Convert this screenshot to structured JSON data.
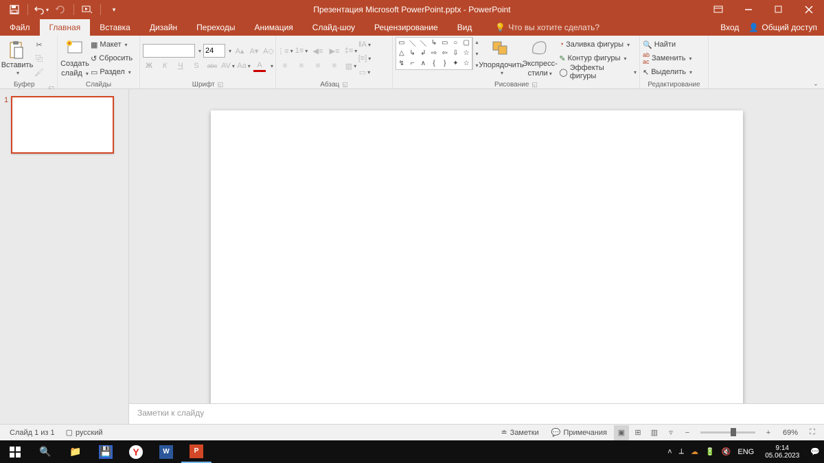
{
  "title": "Презентация Microsoft PowerPoint.pptx - PowerPoint",
  "tabs": {
    "file": "Файл",
    "home": "Главная",
    "insert": "Вставка",
    "design": "Дизайн",
    "transitions": "Переходы",
    "animations": "Анимация",
    "slideshow": "Слайд-шоу",
    "review": "Рецензирование",
    "view": "Вид"
  },
  "tellme": "Что вы хотите сделать?",
  "signin": "Вход",
  "share": "Общий доступ",
  "ribbon": {
    "clipboard": {
      "paste": "Вставить",
      "label": "Буфер обмена"
    },
    "slides": {
      "new": "Создать",
      "new2": "слайд",
      "layout": "Макет",
      "reset": "Сбросить",
      "section": "Раздел",
      "label": "Слайды"
    },
    "font": {
      "size": "24",
      "label": "Шрифт",
      "bold": "Ж",
      "italic": "К",
      "underline": "Ч",
      "strike": "abc"
    },
    "paragraph": {
      "label": "Абзац"
    },
    "drawing": {
      "arrange": "Упорядочить",
      "styles": "Экспресс-",
      "styles2": "стили",
      "fill": "Заливка фигуры",
      "outline": "Контур фигуры",
      "effects": "Эффекты фигуры",
      "label": "Рисование"
    },
    "editing": {
      "find": "Найти",
      "replace": "Заменить",
      "select": "Выделить",
      "label": "Редактирование"
    }
  },
  "slide_num": "1",
  "notes_placeholder": "Заметки к слайду",
  "status": {
    "slide": "Слайд 1 из 1",
    "lang": "русский",
    "notes": "Заметки",
    "comments": "Примечания",
    "zoom": "69%"
  },
  "tray": {
    "lang": "ENG",
    "time": "9:14",
    "date": "05.06.2023"
  }
}
